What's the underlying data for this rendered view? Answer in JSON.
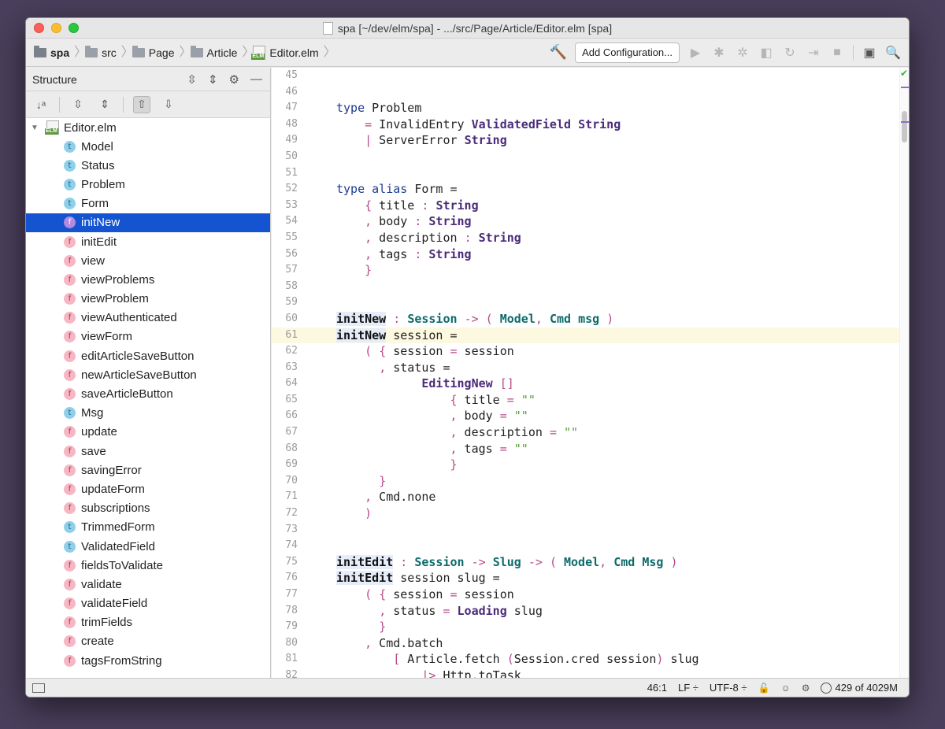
{
  "window": {
    "title": "spa [~/dev/elm/spa] - .../src/Page/Article/Editor.elm [spa]"
  },
  "breadcrumbs": [
    {
      "label": "spa",
      "icon": "folder-icon"
    },
    {
      "label": "src",
      "icon": "folder-icon"
    },
    {
      "label": "Page",
      "icon": "folder-icon"
    },
    {
      "label": "Article",
      "icon": "folder-icon"
    },
    {
      "label": "Editor.elm",
      "icon": "elm-file-icon"
    }
  ],
  "toolbar": {
    "add_configuration": "Add Configuration...",
    "elm_badge": "ELM"
  },
  "structure": {
    "title": "Structure",
    "root": "Editor.elm",
    "items": [
      {
        "kind": "t",
        "label": "Model"
      },
      {
        "kind": "t",
        "label": "Status"
      },
      {
        "kind": "t",
        "label": "Problem"
      },
      {
        "kind": "t",
        "label": "Form"
      },
      {
        "kind": "f",
        "label": "initNew",
        "selected": true
      },
      {
        "kind": "f",
        "label": "initEdit"
      },
      {
        "kind": "f",
        "label": "view"
      },
      {
        "kind": "f",
        "label": "viewProblems"
      },
      {
        "kind": "f",
        "label": "viewProblem"
      },
      {
        "kind": "f",
        "label": "viewAuthenticated"
      },
      {
        "kind": "f",
        "label": "viewForm"
      },
      {
        "kind": "f",
        "label": "editArticleSaveButton"
      },
      {
        "kind": "f",
        "label": "newArticleSaveButton"
      },
      {
        "kind": "f",
        "label": "saveArticleButton"
      },
      {
        "kind": "t",
        "label": "Msg"
      },
      {
        "kind": "f",
        "label": "update"
      },
      {
        "kind": "f",
        "label": "save"
      },
      {
        "kind": "f",
        "label": "savingError"
      },
      {
        "kind": "f",
        "label": "updateForm"
      },
      {
        "kind": "f",
        "label": "subscriptions"
      },
      {
        "kind": "t",
        "label": "TrimmedForm"
      },
      {
        "kind": "t",
        "label": "ValidatedField"
      },
      {
        "kind": "f",
        "label": "fieldsToValidate"
      },
      {
        "kind": "f",
        "label": "validate"
      },
      {
        "kind": "f",
        "label": "validateField"
      },
      {
        "kind": "f",
        "label": "trimFields"
      },
      {
        "kind": "f",
        "label": "create"
      },
      {
        "kind": "f",
        "label": "tagsFromString"
      }
    ]
  },
  "editor": {
    "first_line_number": 45,
    "current_line": 61,
    "lines": [
      "",
      "",
      "type Problem",
      "    = InvalidEntry ValidatedField String",
      "    | ServerError String",
      "",
      "",
      "type alias Form =",
      "    { title : String",
      "    , body : String",
      "    , description : String",
      "    , tags : String",
      "    }",
      "",
      "",
      "initNew : Session -> ( Model, Cmd msg )",
      "initNew session =",
      "    ( { session = session",
      "      , status =",
      "            EditingNew []",
      "                { title = \"\"",
      "                , body = \"\"",
      "                , description = \"\"",
      "                , tags = \"\"",
      "                }",
      "      }",
      "    , Cmd.none",
      "    )",
      "",
      "",
      "initEdit : Session -> Slug -> ( Model, Cmd Msg )",
      "initEdit session slug =",
      "    ( { session = session",
      "      , status = Loading slug",
      "      }",
      "    , Cmd.batch",
      "        [ Article.fetch (Session.cred session) slug",
      "            |> Http.toTask"
    ]
  },
  "status": {
    "position": "46:1",
    "line_ending": "LF ÷",
    "encoding": "UTF-8 ÷",
    "memory": "429 of 4029M"
  }
}
